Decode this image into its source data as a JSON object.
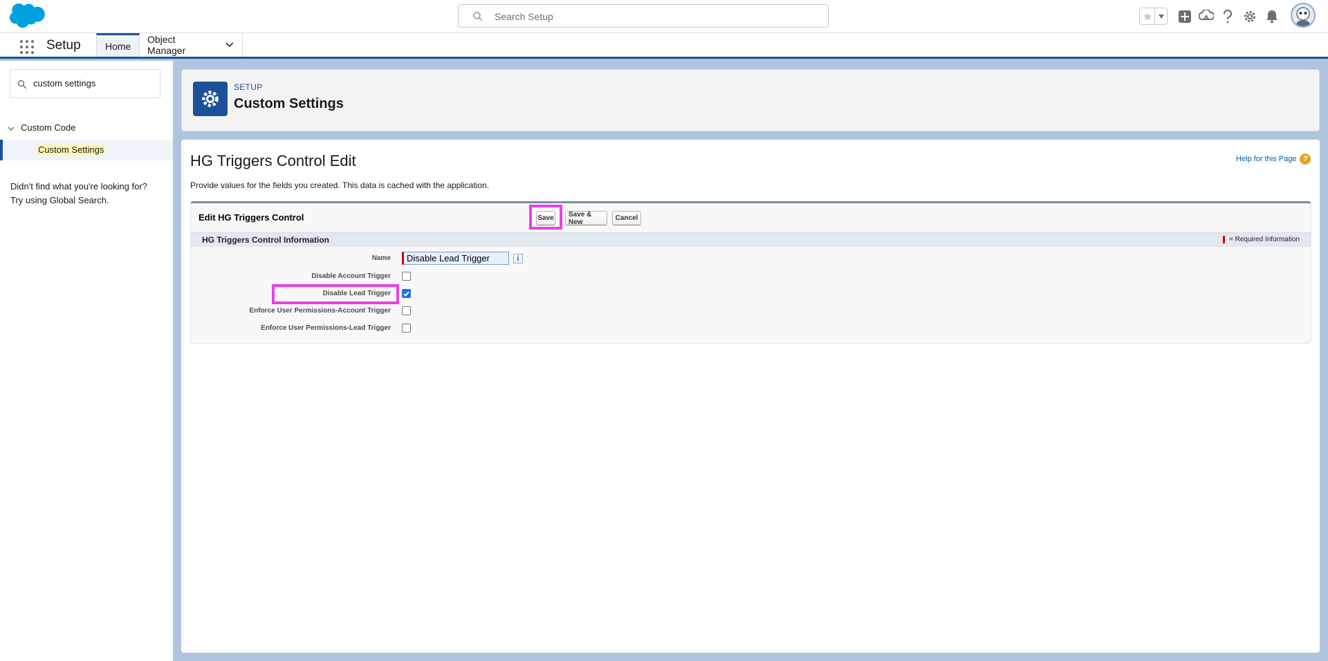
{
  "header": {
    "search_placeholder": "Search Setup"
  },
  "context_bar": {
    "app_name": "Setup",
    "tabs": [
      {
        "label": "Home",
        "active": true
      },
      {
        "label": "Object Manager",
        "active": false
      }
    ]
  },
  "sidebar": {
    "quick_find_value": "custom settings",
    "group_label": "Custom Code",
    "item_label": "Custom Settings",
    "not_found_line1": "Didn't find what you're looking for?",
    "not_found_line2": "Try using Global Search."
  },
  "page_header": {
    "eyebrow": "SETUP",
    "title": "Custom Settings"
  },
  "main": {
    "title": "HG Triggers Control Edit",
    "help_link": "Help for this Page",
    "description": "Provide values for the fields you created. This data is cached with the application.",
    "block_title": "Edit HG Triggers Control",
    "buttons": {
      "save": "Save",
      "save_new": "Save & New",
      "cancel": "Cancel"
    },
    "section_title": "HG Triggers Control Information",
    "required_legend": "= Required Information",
    "fields": {
      "name_label": "Name",
      "name_value": "Disable Lead Trigger",
      "info_glyph": "i",
      "rows": [
        {
          "label": "Disable Account Trigger",
          "checked": false
        },
        {
          "label": "Disable Lead Trigger",
          "checked": true
        },
        {
          "label": "Enforce User Permissions-Account Trigger",
          "checked": false
        },
        {
          "label": "Enforce User Permissions-Lead Trigger",
          "checked": false
        }
      ]
    }
  },
  "colors": {
    "brand_blue": "#1b5297",
    "highlight_magenta": "#ec3ee8",
    "required_red": "#cc0000",
    "salesforce_cloud": "#00a1e0"
  }
}
